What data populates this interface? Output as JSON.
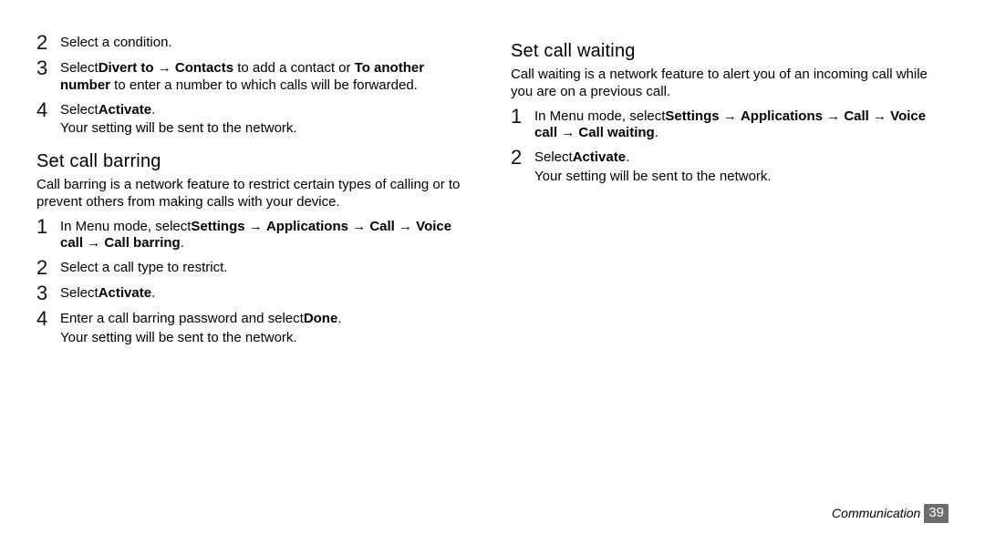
{
  "arrow": "→",
  "left": {
    "steps_a": [
      {
        "n": "2",
        "text": "Select a condition."
      },
      {
        "n": "3",
        "prefix": "Select",
        "bold1": "Divert to",
        "mid1": " ",
        "bold2": "Contacts",
        "mid2": " to add a contact or ",
        "bold3": "To another number",
        "suffix": " to enter a number to which calls will be forwarded."
      },
      {
        "n": "4",
        "prefix": "Select",
        "bold1": "Activate",
        "suffix": ".",
        "note": "Your setting will be sent to the network."
      }
    ],
    "barring": {
      "title": "Set call barring",
      "intro": "Call barring is a network feature to restrict certain types of calling or to prevent others from making calls with your device.",
      "steps": [
        {
          "n": "1",
          "prefix": "In Menu mode, select",
          "chain": [
            "Settings",
            "Applications",
            "Call",
            "Voice call",
            "Call barring"
          ],
          "suffix": "."
        },
        {
          "n": "2",
          "text": "Select a call type to restrict."
        },
        {
          "n": "3",
          "prefix": "Select",
          "bold1": "Activate",
          "suffix": "."
        },
        {
          "n": "4",
          "prefix": "Enter a call barring password and select",
          "bold1": "Done",
          "suffix": ".",
          "note": "Your setting will be sent to the network."
        }
      ]
    }
  },
  "right": {
    "waiting": {
      "title": "Set call waiting",
      "intro": "Call waiting is a network feature to alert you of an incoming call while you are on a previous call.",
      "steps": [
        {
          "n": "1",
          "prefix": "In Menu mode, select",
          "chain": [
            "Settings",
            "Applications",
            "Call",
            "Voice call",
            "Call waiting"
          ],
          "suffix": "."
        },
        {
          "n": "2",
          "prefix": "Select",
          "bold1": "Activate",
          "suffix": ".",
          "note": "Your setting will be sent to the network."
        }
      ]
    }
  },
  "footer": {
    "label": "Communication",
    "page": "39"
  }
}
